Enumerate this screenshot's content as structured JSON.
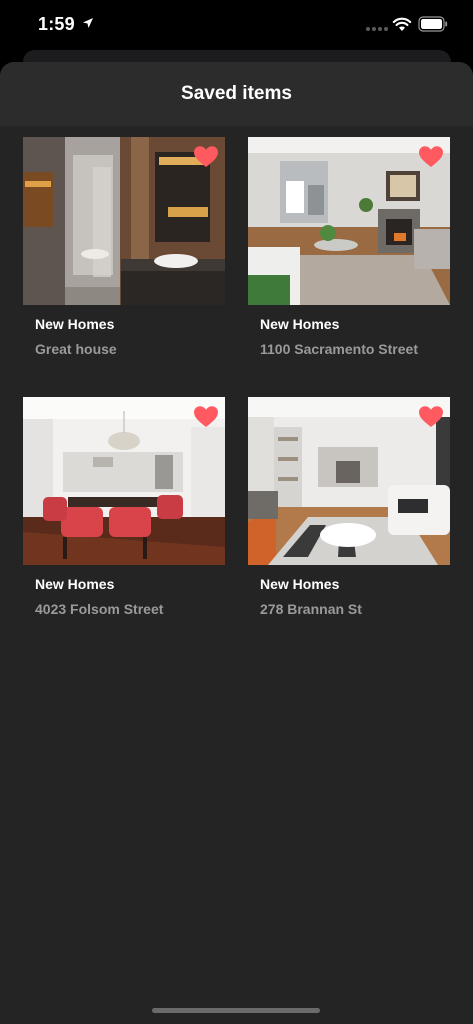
{
  "status_bar": {
    "time": "1:59"
  },
  "sheet": {
    "title": "Saved items"
  },
  "accent_color": "#ff5a5f",
  "items": [
    {
      "category": "New Homes",
      "title": "Great house",
      "photo": "bathroom-photo",
      "saved": true
    },
    {
      "category": "New Homes",
      "title": "1100 Sacramento Street",
      "photo": "living-room-photo",
      "saved": true
    },
    {
      "category": "New Homes",
      "title": "4023 Folsom Street",
      "photo": "dining-room-photo",
      "saved": true
    },
    {
      "category": "New Homes",
      "title": "278 Brannan St",
      "photo": "lounge-photo",
      "saved": true
    }
  ]
}
